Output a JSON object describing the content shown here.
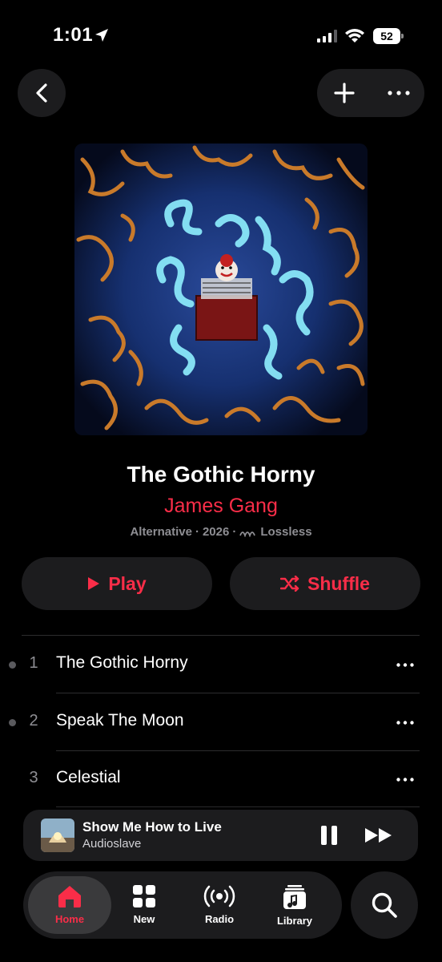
{
  "status_bar": {
    "time": "1:01",
    "battery": "52"
  },
  "nav": {
    "back_icon": "chevron-left-icon",
    "add_icon": "plus-icon",
    "more_icon": "ellipsis-icon"
  },
  "album": {
    "title": "The Gothic Horny",
    "artist": "James Gang",
    "genre": "Alternative",
    "year": "2026",
    "quality": "Lossless",
    "separator": "·"
  },
  "actions": {
    "play_label": "Play",
    "shuffle_label": "Shuffle"
  },
  "tracks": [
    {
      "number": "1",
      "title": "The Gothic Horny",
      "playing_dot": true
    },
    {
      "number": "2",
      "title": "Speak The Moon",
      "playing_dot": true
    },
    {
      "number": "3",
      "title": "Celestial",
      "playing_dot": false
    }
  ],
  "now_playing": {
    "title": "Show Me How to Live",
    "artist": "Audioslave"
  },
  "tab_bar": {
    "tabs": [
      {
        "label": "Home",
        "icon": "home-icon",
        "active": true
      },
      {
        "label": "New",
        "icon": "grid-icon",
        "active": false
      },
      {
        "label": "Radio",
        "icon": "radio-icon",
        "active": false
      },
      {
        "label": "Library",
        "icon": "library-icon",
        "active": false
      }
    ],
    "search_icon": "search-icon"
  },
  "colors": {
    "accent": "#fa2d48",
    "background": "#000000",
    "surface": "#1c1c1e",
    "secondary_text": "#8e8e93"
  }
}
